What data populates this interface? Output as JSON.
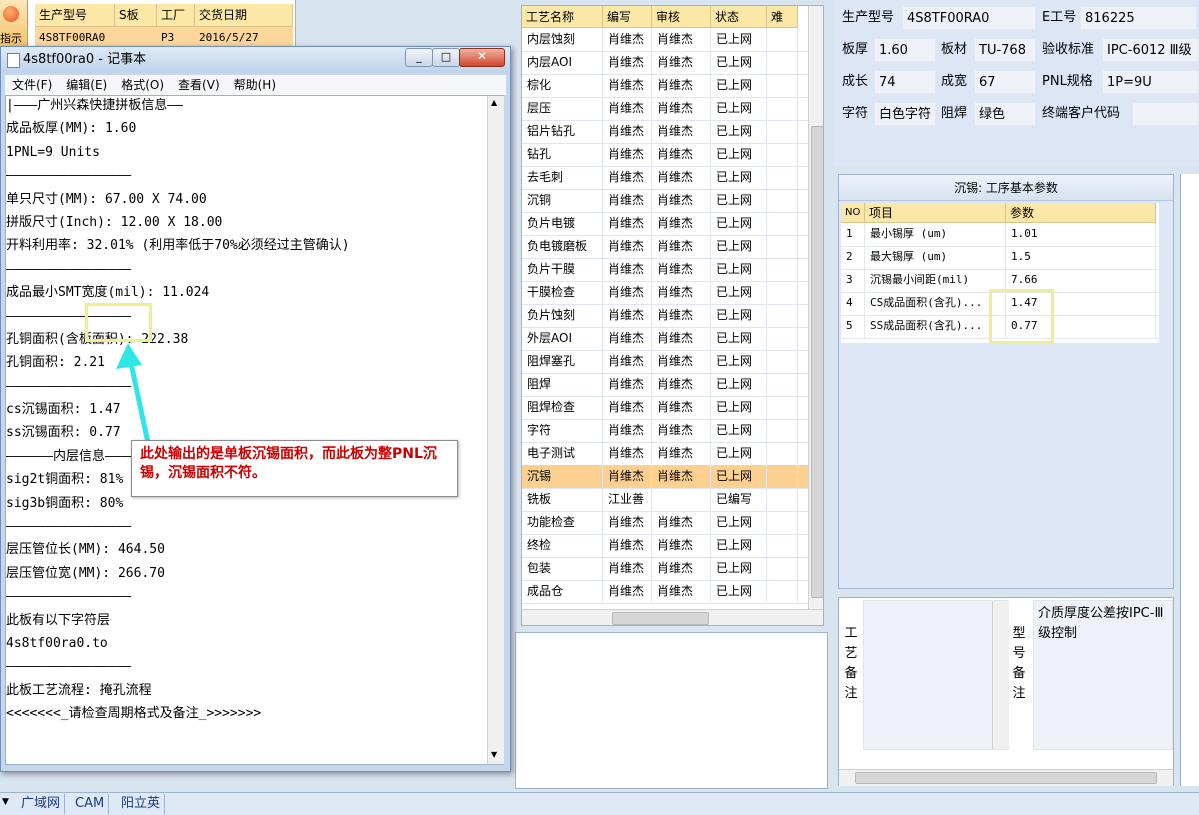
{
  "order_grid": {
    "headers": [
      "生产型号",
      "S板",
      "工厂",
      "交货日期"
    ],
    "row": [
      "4S8TF00RA0",
      "",
      "P3",
      "2016/5/27"
    ],
    "side_button_label": "指示"
  },
  "process_grid": {
    "headers": [
      "工艺名称",
      "编写",
      "审核",
      "状态",
      "难"
    ],
    "rows": [
      [
        "内层蚀刻",
        "肖维杰",
        "肖维杰",
        "已上网"
      ],
      [
        "内层AOI",
        "肖维杰",
        "肖维杰",
        "已上网"
      ],
      [
        "棕化",
        "肖维杰",
        "肖维杰",
        "已上网"
      ],
      [
        "层压",
        "肖维杰",
        "肖维杰",
        "已上网"
      ],
      [
        "铝片钻孔",
        "肖维杰",
        "肖维杰",
        "已上网"
      ],
      [
        "钻孔",
        "肖维杰",
        "肖维杰",
        "已上网"
      ],
      [
        "去毛刺",
        "肖维杰",
        "肖维杰",
        "已上网"
      ],
      [
        "沉铜",
        "肖维杰",
        "肖维杰",
        "已上网"
      ],
      [
        "负片电镀",
        "肖维杰",
        "肖维杰",
        "已上网"
      ],
      [
        "负电镀磨板",
        "肖维杰",
        "肖维杰",
        "已上网"
      ],
      [
        "负片干膜",
        "肖维杰",
        "肖维杰",
        "已上网"
      ],
      [
        "干膜检查",
        "肖维杰",
        "肖维杰",
        "已上网"
      ],
      [
        "负片蚀刻",
        "肖维杰",
        "肖维杰",
        "已上网"
      ],
      [
        "外层AOI",
        "肖维杰",
        "肖维杰",
        "已上网"
      ],
      [
        "阻焊塞孔",
        "肖维杰",
        "肖维杰",
        "已上网"
      ],
      [
        "阻焊",
        "肖维杰",
        "肖维杰",
        "已上网"
      ],
      [
        "阻焊检查",
        "肖维杰",
        "肖维杰",
        "已上网"
      ],
      [
        "字符",
        "肖维杰",
        "肖维杰",
        "已上网"
      ],
      [
        "电子测试",
        "肖维杰",
        "肖维杰",
        "已上网"
      ],
      [
        "沉锡",
        "肖维杰",
        "肖维杰",
        "已上网"
      ],
      [
        "铣板",
        "江业善",
        "",
        "已编写"
      ],
      [
        "功能检查",
        "肖维杰",
        "肖维杰",
        "已上网"
      ],
      [
        "终检",
        "肖维杰",
        "肖维杰",
        "已上网"
      ],
      [
        "包装",
        "肖维杰",
        "肖维杰",
        "已上网"
      ],
      [
        "成品仓",
        "肖维杰",
        "肖维杰",
        "已上网"
      ]
    ],
    "selected_index": 19
  },
  "info": {
    "model_label": "生产型号",
    "model_value": "4S8TF00RA0",
    "eno_label": "E工号",
    "eno_value": "816225",
    "thickness_label": "板厚",
    "thickness_value": "1.60",
    "material_label": "板材",
    "material_value": "TU-768",
    "standard_label": "验收标准",
    "standard_value": "IPC-6012 Ⅲ级",
    "length_label": "成长",
    "length_value": "74",
    "width_label": "成宽",
    "width_value": "67",
    "pnl_label": "PNL规格",
    "pnl_value": "1P=9U",
    "legend_label": "字符",
    "legend_value": "白色字符",
    "mask_label": "阻焊",
    "mask_value": "绿色",
    "customer_label": "终端客户代码",
    "customer_value": ""
  },
  "params": {
    "title": "沉锡: 工序基本参数",
    "headers": [
      "NO",
      "项目",
      "参数"
    ],
    "rows": [
      [
        "1",
        "最小锡厚 (um)",
        "1.01"
      ],
      [
        "2",
        "最大锡厚 (um)",
        "1.5"
      ],
      [
        "3",
        "沉锡最小间距(mil)",
        "7.66"
      ],
      [
        "4",
        "CS成品面积(含孔)...",
        "1.47"
      ],
      [
        "5",
        "SS成品面积(含孔)...",
        "0.77"
      ]
    ]
  },
  "remarks": {
    "process_label": "工艺备注",
    "model_label": "型号备注",
    "model_text": "介质厚度公差按IPC-Ⅲ级控制"
  },
  "notepad": {
    "title": "4s8tf00ra0 - 记事本",
    "menu": [
      "文件(F)",
      "编辑(E)",
      "格式(O)",
      "查看(V)",
      "帮助(H)"
    ],
    "lines": [
      "|———广州兴森快捷拼板信息——",
      "成品板厚(MM): 1.60",
      "1PNL=9 Units",
      "————————————————",
      "单只尺寸(MM): 67.00 X 74.00",
      "拼版尺寸(Inch): 12.00 X 18.00",
      "开料利用率: 32.01% (利用率低于70%必须经过主管确认)",
      "————————————————",
      "成品最小SMT宽度(mil): 11.024",
      "————————————————",
      "孔铜面积(含板面积): 222.38",
      "孔铜面积: 2.21",
      "————————————————",
      "cs沉锡面积: 1.47",
      "ss沉锡面积: 0.77",
      "——————内层信息——————",
      "sig2t铜面积: 81%",
      "sig3b铜面积: 80%",
      "————————————————",
      "层压管位长(MM): 464.50",
      "层压管位宽(MM): 266.70",
      "————————————————",
      "此板有以下字符层",
      "4s8tf00ra0.to",
      "————————————————",
      "此板工艺流程: 掩孔流程",
      "<<<<<<<_请检查周期格式及备注_>>>>>>>"
    ]
  },
  "callout": {
    "text": "此处输出的是单板沉锡面积，而此板为整PNL沉锡，沉锡面积不符。"
  },
  "status_bar": {
    "tabs": [
      "广域网",
      "CAM",
      "阳立英"
    ]
  },
  "colors": {
    "selected_row": "#fdd08f",
    "header_bg": "#fbe8a6",
    "highlight_box": "#f4ee8a",
    "arrow": "#2ee6e6",
    "callout_text": "#cc0000"
  }
}
